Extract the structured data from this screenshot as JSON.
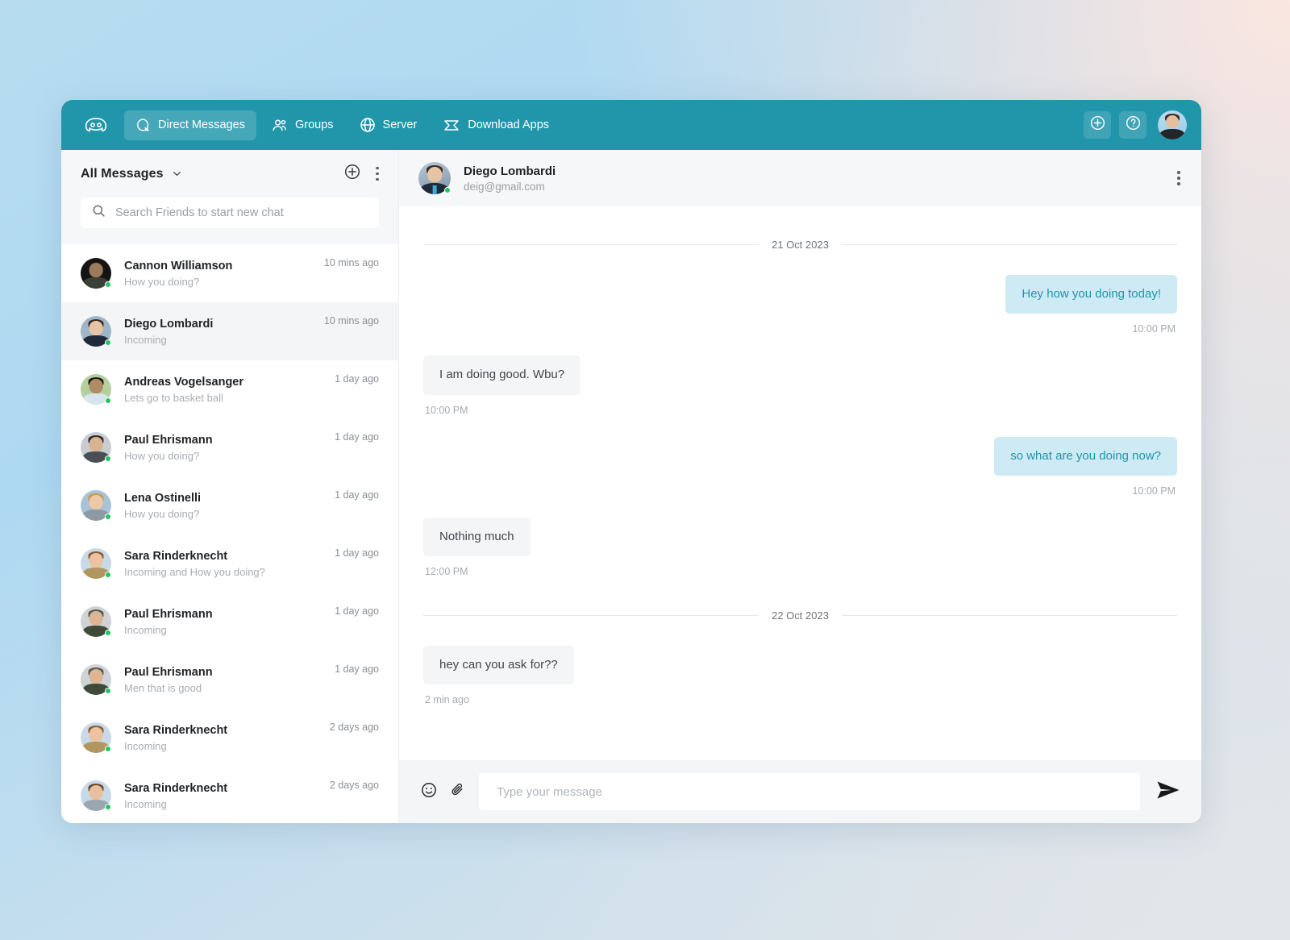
{
  "app": {
    "brand_icon": "discord-logo-icon"
  },
  "navbar": {
    "items": [
      {
        "label": "Direct Messages",
        "icon": "chat-bubble-icon",
        "active": true
      },
      {
        "label": "Groups",
        "icon": "people-icon",
        "active": false
      },
      {
        "label": "Server",
        "icon": "globe-icon",
        "active": false
      },
      {
        "label": "Download Apps",
        "icon": "download-apps-icon",
        "active": false
      }
    ],
    "add_button_icon": "plus-circle-icon",
    "help_button_icon": "question-circle-icon",
    "avatar_icon": "user-avatar"
  },
  "sidebar": {
    "filter_label": "All Messages",
    "chevron_icon": "chevron-down-icon",
    "new_chat_icon": "plus-circle-icon",
    "more_icon": "more-vertical-icon",
    "search": {
      "placeholder": "Search Friends to start new chat",
      "value": "",
      "icon": "search-icon"
    },
    "chats": [
      {
        "name": "Cannon Williamson",
        "preview": "How you doing?",
        "time": "10 mins ago",
        "online": true,
        "selected": false
      },
      {
        "name": "Diego Lombardi",
        "preview": "Incoming",
        "time": "10 mins ago",
        "online": true,
        "selected": true
      },
      {
        "name": "Andreas Vogelsanger",
        "preview": "Lets go to basket ball",
        "time": "1 day ago",
        "online": true,
        "selected": false
      },
      {
        "name": "Paul Ehrismann",
        "preview": "How you doing?",
        "time": "1 day ago",
        "online": true,
        "selected": false
      },
      {
        "name": "Lena Ostinelli",
        "preview": "How you doing?",
        "time": "1 day ago",
        "online": true,
        "selected": false
      },
      {
        "name": "Sara Rinderknecht",
        "preview": "Incoming and How you doing?",
        "time": "1 day ago",
        "online": true,
        "selected": false
      },
      {
        "name": "Paul Ehrismann",
        "preview": "Incoming",
        "time": "1 day ago",
        "online": true,
        "selected": false
      },
      {
        "name": "Paul Ehrismann",
        "preview": "Men that is good",
        "time": "1 day ago",
        "online": true,
        "selected": false
      },
      {
        "name": "Sara Rinderknecht",
        "preview": "Incoming",
        "time": "2 days ago",
        "online": true,
        "selected": false
      },
      {
        "name": "Sara Rinderknecht",
        "preview": "Incoming",
        "time": "2 days ago",
        "online": true,
        "selected": false
      }
    ]
  },
  "conversation": {
    "header": {
      "name": "Diego Lombardi",
      "email": "deig@gmail.com",
      "more_icon": "more-vertical-icon",
      "online": true
    },
    "items": [
      {
        "kind": "date",
        "text": "21 Oct 2023"
      },
      {
        "kind": "message",
        "direction": "out",
        "text": "Hey how you doing today!",
        "time": "10:00 PM"
      },
      {
        "kind": "message",
        "direction": "in",
        "text": "I am doing good. Wbu?",
        "time": "10:00 PM"
      },
      {
        "kind": "message",
        "direction": "out",
        "text": "so what are you doing now?",
        "time": "10:00 PM"
      },
      {
        "kind": "message",
        "direction": "in",
        "text": "Nothing much",
        "time": "12:00 PM"
      },
      {
        "kind": "date",
        "text": "22 Oct 2023"
      },
      {
        "kind": "message",
        "direction": "in",
        "text": "hey can you ask for??",
        "time": "2 min ago"
      }
    ],
    "composer": {
      "emoji_icon": "emoji-smiley-icon",
      "attach_icon": "paperclip-icon",
      "placeholder": "Type your message",
      "value": "",
      "send_icon": "send-plane-icon"
    }
  },
  "colors": {
    "brand_teal": "#2196ab",
    "outgoing_bubble": "#cdeaf5",
    "outgoing_text": "#2196ab",
    "incoming_bubble": "#f4f5f7",
    "online_green": "#22c55e",
    "panel_gray": "#f6f7f8"
  }
}
